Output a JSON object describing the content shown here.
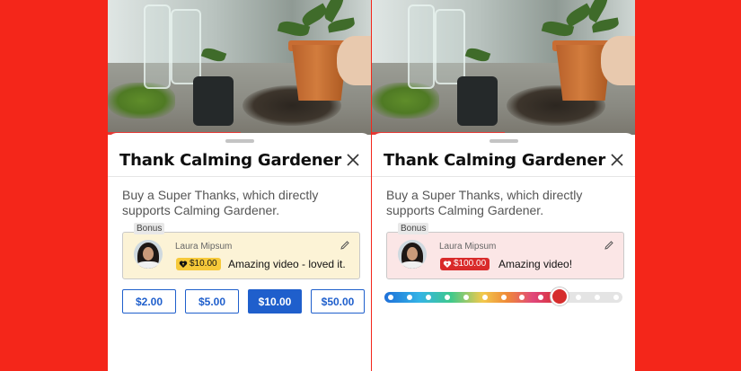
{
  "left_panel": {
    "title": "Thank Calming Gardener",
    "description": "Buy a Super Thanks, which directly supports Calming Gardener.",
    "bonus_label": "Bonus",
    "card": {
      "name": "Laura Mipsum",
      "amount": "$10.00",
      "message": "Amazing video - loved it."
    },
    "amount_options": [
      "$2.00",
      "$5.00",
      "$10.00",
      "$50.00"
    ],
    "selected_amount": "$10.00"
  },
  "right_panel": {
    "title": "Thank Calming Gardener",
    "description": "Buy a Super Thanks, which directly supports Calming Gardener.",
    "bonus_label": "Bonus",
    "card": {
      "name": "Laura Mipsum",
      "amount": "$100.00",
      "message": "Amazing video!"
    },
    "slider": {
      "stops": 13,
      "selected_stop": 9
    }
  },
  "colors": {
    "background": "#f4261a",
    "accent_blue": "#1f5fcc",
    "badge_yellow": "#f6c93a",
    "badge_red": "#d92a2a",
    "card_yellow": "#fcf3d6",
    "card_pink": "#fbe6e6"
  },
  "icons": {
    "close": "close-icon",
    "edit": "pencil-icon",
    "badge": "heart-icon"
  }
}
